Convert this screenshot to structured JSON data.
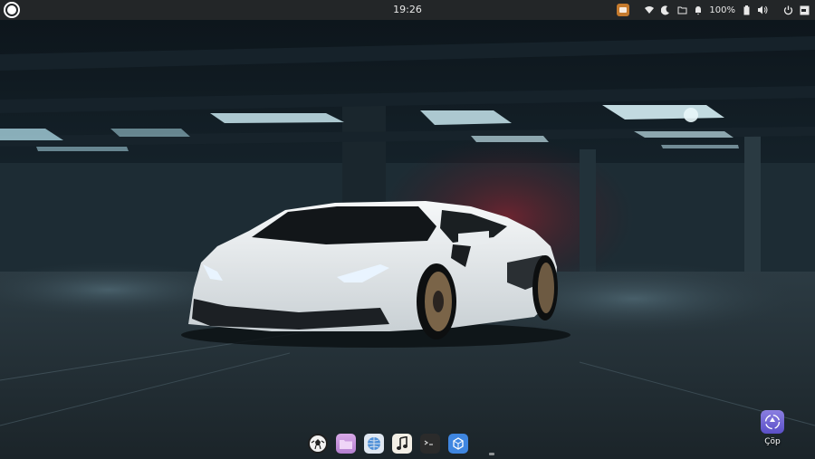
{
  "topbar": {
    "clock": "19:26",
    "battery_percent": "100%"
  },
  "dock": {
    "items": [
      {
        "name": "ball-app-icon"
      },
      {
        "name": "files-folder-icon"
      },
      {
        "name": "web-browser-icon"
      },
      {
        "name": "music-player-icon"
      },
      {
        "name": "terminal-icon"
      },
      {
        "name": "software-store-icon"
      }
    ]
  },
  "desktop": {
    "trash_label": "Çöp"
  },
  "colors": {
    "topbar_bg": "#232628",
    "accent_trash": "#6b5fd4"
  }
}
